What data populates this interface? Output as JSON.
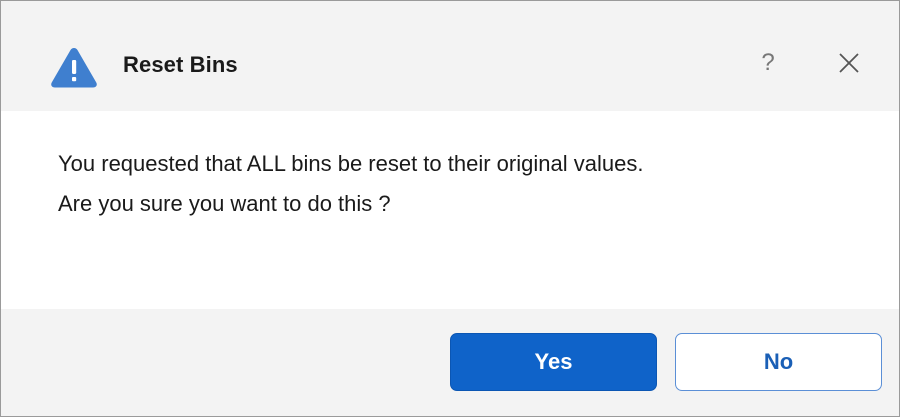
{
  "dialog": {
    "title": "Reset Bins",
    "title_icon": "warning-icon",
    "help_label": "?",
    "close_icon": "close-icon",
    "message_lines": [
      "You requested that ALL bins be reset to their original values.",
      "Are you sure you want to do this ?"
    ],
    "buttons": {
      "yes_label": "Yes",
      "no_label": "No"
    }
  },
  "colors": {
    "warning_icon": "#3f7fcf",
    "primary_button": "#0f63c9",
    "secondary_button_border": "#5b8fd6",
    "band_background": "#f3f3f3"
  }
}
